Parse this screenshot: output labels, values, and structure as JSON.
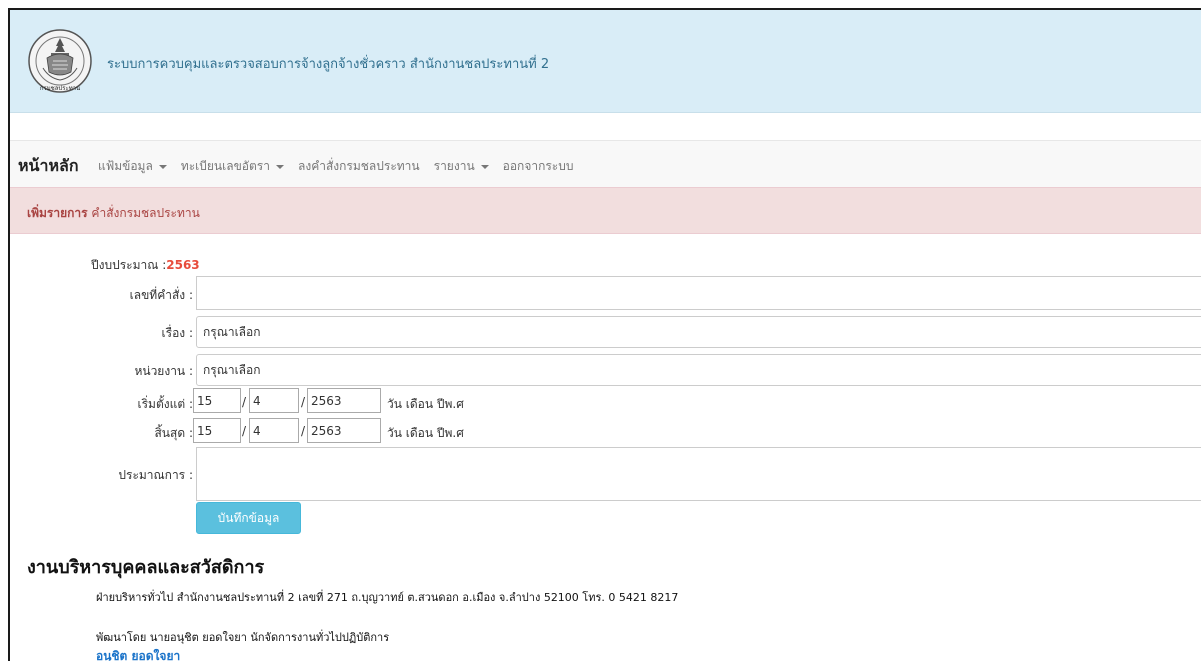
{
  "header": {
    "logo_icon": "royal-irrigation-seal-icon",
    "logo_text": "กรมชลประทาน",
    "title": "ระบบการควบคุมและตรวจสอบการจ้างลูกจ้างชั่วคราว สำนักงานชลประทานที่ 2"
  },
  "nav": {
    "brand": "หน้าหลัก",
    "items": [
      {
        "label": "แฟ้มข้อมูล",
        "dropdown": true
      },
      {
        "label": "ทะเบียนเลขอัตรา",
        "dropdown": true
      },
      {
        "label": "ลงคำสั่งกรมชลประทาน",
        "dropdown": false
      },
      {
        "label": "รายงาน",
        "dropdown": true
      },
      {
        "label": "ออกจากระบบ",
        "dropdown": false
      }
    ]
  },
  "alert": {
    "strong": "เพิ่มรายการ",
    "text": "คำสั่งกรมชลประทาน"
  },
  "form": {
    "year_label": "ปีงบประมาณ :",
    "year_value": "2563",
    "order_no_label": "เลขที่คำสั่ง :",
    "order_no_value": "",
    "subject_label": "เรื่อง :",
    "subject_selected": "กรุณาเลือก",
    "unit_label": "หน่วยงาน :",
    "unit_selected": "กรุณาเลือก",
    "start_label": "เริ่มตั้งแต่ :",
    "start_day": "15",
    "start_month": "4",
    "start_year": "2563",
    "end_label": "สิ้นสุด :",
    "end_day": "15",
    "end_month": "4",
    "end_year": "2563",
    "date_unit": "วัน เดือน ปีพ.ศ",
    "slash": "/",
    "estimate_label": "ประมาณการ :",
    "estimate_value": "",
    "submit_label": "บันทึกข้อมูล"
  },
  "footer": {
    "title": "งานบริหารบุคคลและสวัสดิการ",
    "address": "ฝ่ายบริหารทั่วไป สำนักงานชลประทานที่ 2 เลขที่ 271 ถ.บุญวาทย์ ต.สวนดอก อ.เมือง จ.ลำปาง 52100 โทร. 0 5421 8217",
    "developer": "พัฒนาโดย นายอนุชิต ยอดใจยา นักจัดการงานทั่วไปปฏิบัติการ",
    "developer_link": "อนุชิต ยอดใจยา"
  },
  "colors": {
    "header_bg": "#d9edf7",
    "alert_bg": "#f2dede",
    "alert_text": "#a94442",
    "year_highlight": "#e74c3c",
    "button_bg": "#5bc0de",
    "link": "#1a73c9"
  }
}
